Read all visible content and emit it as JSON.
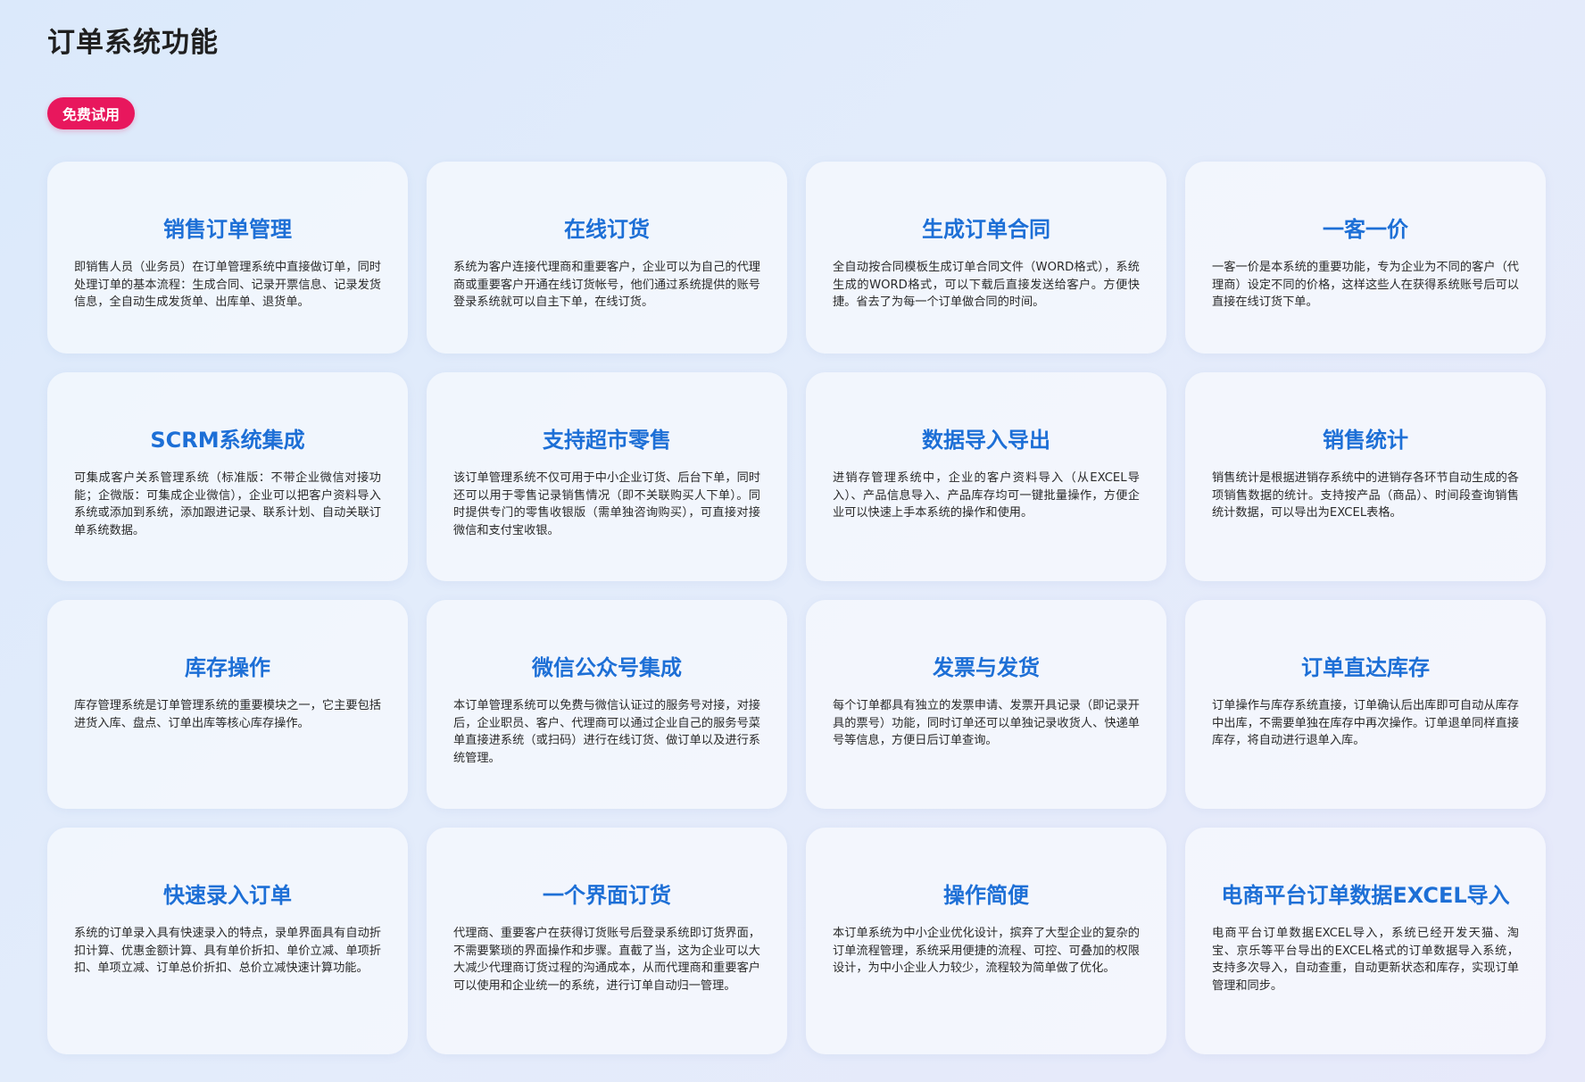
{
  "page": {
    "title": "订单系统功能",
    "trial_button": "免费试用"
  },
  "features": [
    {
      "title": "销售订单管理",
      "desc": "即销售人员（业务员）在订单管理系统中直接做订单，同时处理订单的基本流程：生成合同、记录开票信息、记录发货信息，全自动生成发货单、出库单、退货单。"
    },
    {
      "title": "在线订货",
      "desc": "系统为客户连接代理商和重要客户，企业可以为自己的代理商或重要客户开通在线订货帐号，他们通过系统提供的账号登录系统就可以自主下单，在线订货。"
    },
    {
      "title": "生成订单合同",
      "desc": "全自动按合同模板生成订单合同文件（WORD格式），系统生成的WORD格式，可以下载后直接发送给客户。方便快捷。省去了为每一个订单做合同的时间。"
    },
    {
      "title": "一客一价",
      "desc": "一客一价是本系统的重要功能，专为企业为不同的客户（代理商）设定不同的价格，这样这些人在获得系统账号后可以直接在线订货下单。"
    },
    {
      "title": "SCRM系统集成",
      "desc": "可集成客户关系管理系统（标准版：不带企业微信对接功能；企微版：可集成企业微信），企业可以把客户资料导入系统或添加到系统，添加跟进记录、联系计划、自动关联订单系统数据。"
    },
    {
      "title": "支持超市零售",
      "desc": "该订单管理系统不仅可用于中小企业订货、后台下单，同时还可以用于零售记录销售情况（即不关联购买人下单）。同时提供专门的零售收银版（需单独咨询购买），可直接对接微信和支付宝收银。"
    },
    {
      "title": "数据导入导出",
      "desc": "进销存管理系统中，企业的客户资料导入（从EXCEL导入）、产品信息导入、产品库存均可一键批量操作，方便企业可以快速上手本系统的操作和使用。"
    },
    {
      "title": "销售统计",
      "desc": "销售统计是根据进销存系统中的进销存各环节自动生成的各项销售数据的统计。支持按产品（商品）、时间段查询销售统计数据，可以导出为EXCEL表格。"
    },
    {
      "title": "库存操作",
      "desc": "库存管理系统是订单管理系统的重要模块之一，它主要包括进货入库、盘点、订单出库等核心库存操作。"
    },
    {
      "title": "微信公众号集成",
      "desc": "本订单管理系统可以免费与微信认证过的服务号对接，对接后，企业职员、客户、代理商可以通过企业自己的服务号菜单直接进系统（或扫码）进行在线订货、做订单以及进行系统管理。"
    },
    {
      "title": "发票与发货",
      "desc": "每个订单都具有独立的发票申请、发票开具记录（即记录开具的票号）功能，同时订单还可以单独记录收货人、快递单号等信息，方便日后订单查询。"
    },
    {
      "title": "订单直达库存",
      "desc": "订单操作与库存系统直接，订单确认后出库即可自动从库存中出库，不需要单独在库存中再次操作。订单退单同样直接库存，将自动进行退单入库。"
    },
    {
      "title": "快速录入订单",
      "desc": "系统的订单录入具有快速录入的特点，录单界面具有自动折扣计算、优惠金额计算、具有单价折扣、单价立减、单项折扣、单项立减、订单总价折扣、总价立减快速计算功能。"
    },
    {
      "title": "一个界面订货",
      "desc": "代理商、重要客户在获得订货账号后登录系统即订货界面，不需要繁琐的界面操作和步骤。直截了当，这为企业可以大大减少代理商订货过程的沟通成本，从而代理商和重要客户可以使用和企业统一的系统，进行订单自动归一管理。"
    },
    {
      "title": "操作简便",
      "desc": "本订单系统为中小企业优化设计，摈弃了大型企业的复杂的订单流程管理，系统采用便捷的流程、可控、可叠加的权限设计，为中小企业人力较少，流程较为简单做了优化。"
    },
    {
      "title": "电商平台订单数据EXCEL导入",
      "desc": "电商平台订单数据EXCEL导入，系统已经开发天猫、淘宝、京乐等平台导出的EXCEL格式的订单数据导入系统，支持多次导入，自动查重，自动更新状态和库存，实现订单管理和同步。"
    }
  ]
}
